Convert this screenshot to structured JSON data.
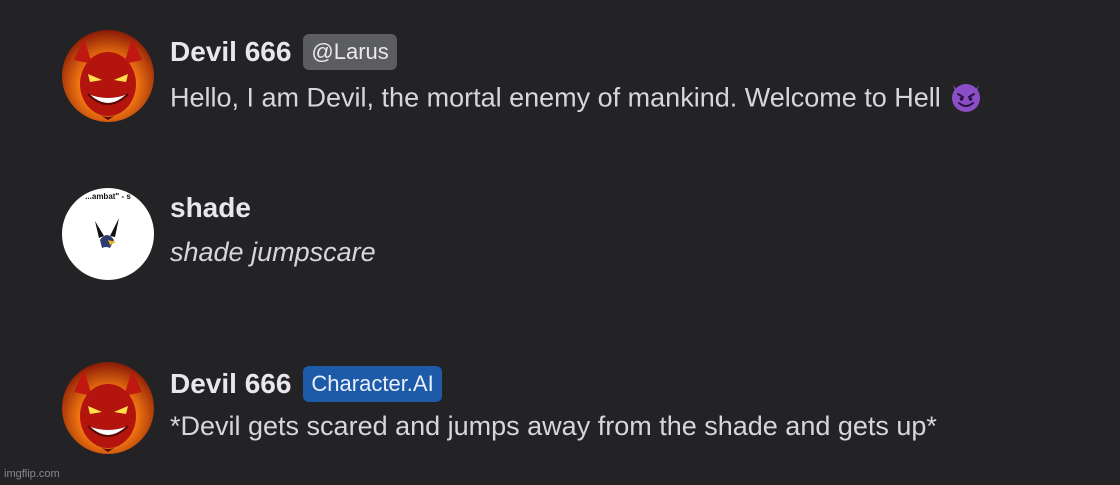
{
  "messages": [
    {
      "username": "Devil 666",
      "badge": "@Larus",
      "text": "Hello, I am Devil, the mortal enemy of mankind. Welcome to Hell",
      "emoji": "smiling-face-with-horns"
    },
    {
      "username": "shade",
      "avatar_caption": "...ambat\" - s",
      "text": "shade jumpscare"
    },
    {
      "username": "Devil 666",
      "badge": "Character.AI",
      "text": "*Devil gets scared and jumps away from the shade and gets up*"
    }
  ],
  "watermark": "imgflip.com",
  "colors": {
    "background": "#232325",
    "username": "#e8e8ea",
    "message_text": "#d7d7d9",
    "badge_gray": "#5c5d61",
    "badge_blue": "#1d5aa8",
    "emoji_purple": "#8a4fc6"
  }
}
